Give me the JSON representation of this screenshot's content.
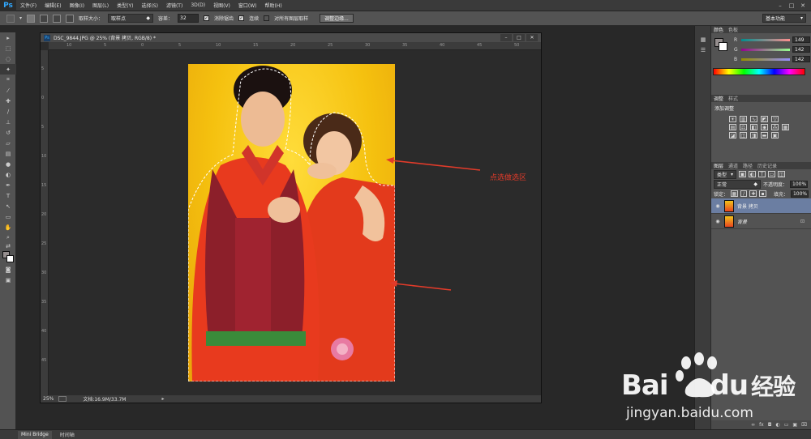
{
  "app": {
    "logo": "Ps"
  },
  "menu": [
    "文件(F)",
    "编辑(E)",
    "图像(I)",
    "图层(L)",
    "类型(Y)",
    "选择(S)",
    "滤镜(T)",
    "3D(D)",
    "视图(V)",
    "窗口(W)",
    "帮助(H)"
  ],
  "options": {
    "sample_size_label": "取样大小：",
    "sample_size_value": "取样点",
    "tolerance_label": "容差：",
    "tolerance_value": "32",
    "antialias_label": "消除锯齿",
    "contiguous_label": "连续",
    "sample_all_label": "对所有图层取样",
    "refine_edge_label": "调整边缘...",
    "workspace_value": "基本功能"
  },
  "document": {
    "title": "DSC_9844.JPG @ 25% (背景 拷贝, RGB/8) *",
    "zoom": "25%",
    "doc_info": "文档:16.9M/33.7M",
    "ruler_top": [
      "10",
      "5",
      "0",
      "5",
      "10",
      "15",
      "20",
      "25",
      "30",
      "35",
      "40",
      "45",
      "50"
    ],
    "ruler_left": [
      "5",
      "0",
      "5",
      "10",
      "15",
      "20",
      "25",
      "30",
      "35",
      "40",
      "45"
    ]
  },
  "annotation": {
    "text": "点选做选区",
    "color": "#e23b2a"
  },
  "color_panel": {
    "tabs": [
      "颜色",
      "色板"
    ],
    "channels": [
      {
        "letter": "R",
        "value": "149"
      },
      {
        "letter": "G",
        "value": "142"
      },
      {
        "letter": "B",
        "value": "142"
      }
    ]
  },
  "adjust_panel": {
    "tabs": [
      "调整",
      "样式"
    ],
    "heading": "添加调整"
  },
  "layers_panel": {
    "tabs": [
      "图层",
      "通道",
      "路径",
      "历史记录"
    ],
    "kind_value": "类型",
    "blend_mode": "正常",
    "opacity_label": "不透明度：",
    "opacity_value": "100%",
    "lock_label": "锁定：",
    "fill_label": "填充：",
    "fill_value": "100%",
    "layers": [
      {
        "name": "背景 拷贝",
        "selected": true
      },
      {
        "name": "背景",
        "selected": false
      }
    ]
  },
  "bottom_tabs": [
    "Mini Bridge",
    "时间轴"
  ],
  "watermark": {
    "brand": "Bai",
    "brand2": "du",
    "cn": "经验",
    "url": "jingyan.baidu.com"
  }
}
